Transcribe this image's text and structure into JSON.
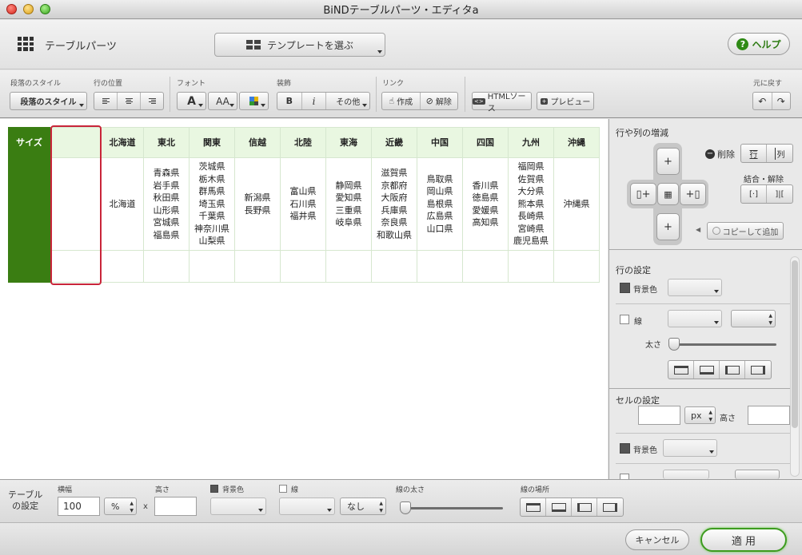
{
  "window": {
    "title": "BiNDテーブルパーツ・エディタa"
  },
  "header": {
    "title": "テーブルパーツ",
    "template_button": "テンプレートを選ぶ",
    "help_button": "ヘルプ"
  },
  "toolbar": {
    "para_style_label": "段落のスタイル",
    "para_style_value": "段落のスタイル",
    "row_pos_label": "行の位置",
    "font_label": "フォント",
    "font_a": "A",
    "font_aa": "AA",
    "decor_label": "装飾",
    "bold": "B",
    "italic": "i",
    "other": "その他",
    "link_label": "リンク",
    "create": "作成",
    "remove": "解除",
    "html_source": "HTMLソース",
    "preview": "プレビュー",
    "undo_label": "元に戻す"
  },
  "table": {
    "size_label": "サイズ",
    "headers": [
      "北海道",
      "東北",
      "関東",
      "信越",
      "北陸",
      "東海",
      "近畿",
      "中国",
      "四国",
      "九州",
      "沖縄"
    ],
    "cells": [
      [
        "北海道"
      ],
      [
        "青森県",
        "岩手県",
        "秋田県",
        "山形県",
        "宮城県",
        "福島県"
      ],
      [
        "茨城県",
        "栃木県",
        "群馬県",
        "埼玉県",
        "千葉県",
        "神奈川県",
        "山梨県"
      ],
      [
        "新潟県",
        "長野県"
      ],
      [
        "富山県",
        "石川県",
        "福井県"
      ],
      [
        "静岡県",
        "愛知県",
        "三重県",
        "岐阜県"
      ],
      [
        "滋賀県",
        "京都府",
        "大阪府",
        "兵庫県",
        "奈良県",
        "和歌山県"
      ],
      [
        "鳥取県",
        "岡山県",
        "島根県",
        "広島県",
        "山口県"
      ],
      [
        "香川県",
        "徳島県",
        "愛媛県",
        "高知県"
      ],
      [
        "福岡県",
        "佐賀県",
        "大分県",
        "熊本県",
        "長崎県",
        "宮崎県",
        "鹿児島県"
      ],
      [
        "沖縄県"
      ]
    ]
  },
  "right_panel": {
    "rowcol_title": "行や列の増減",
    "delete": "削除",
    "row": "行",
    "col": "列",
    "merge_split": "結合・解除",
    "copy_add": "コピーして追加",
    "row_settings_title": "行の設定",
    "bgcolor": "背景色",
    "line": "線",
    "thickness": "太さ",
    "cell_settings_title": "セルの設定",
    "px": "px",
    "height": "高さ"
  },
  "bottom": {
    "table_settings_label": "テーブル\nの設定",
    "width_label": "横幅",
    "width_value": "100",
    "width_unit": "%",
    "times": "x",
    "height_label": "高さ",
    "bgcolor_label": "背景色",
    "line_label": "線",
    "line_style_value": "なし",
    "thickness_label": "線の太さ",
    "line_pos_label": "線の場所",
    "thickness_level": 0.0
  },
  "footer": {
    "cancel": "キャンセル",
    "apply": "適 用"
  },
  "colors": {
    "accent_green": "#3a7d12",
    "header_cell_bg": "#e9f7e1",
    "selection_red": "#c9253a",
    "help_green": "#2f8a16"
  }
}
